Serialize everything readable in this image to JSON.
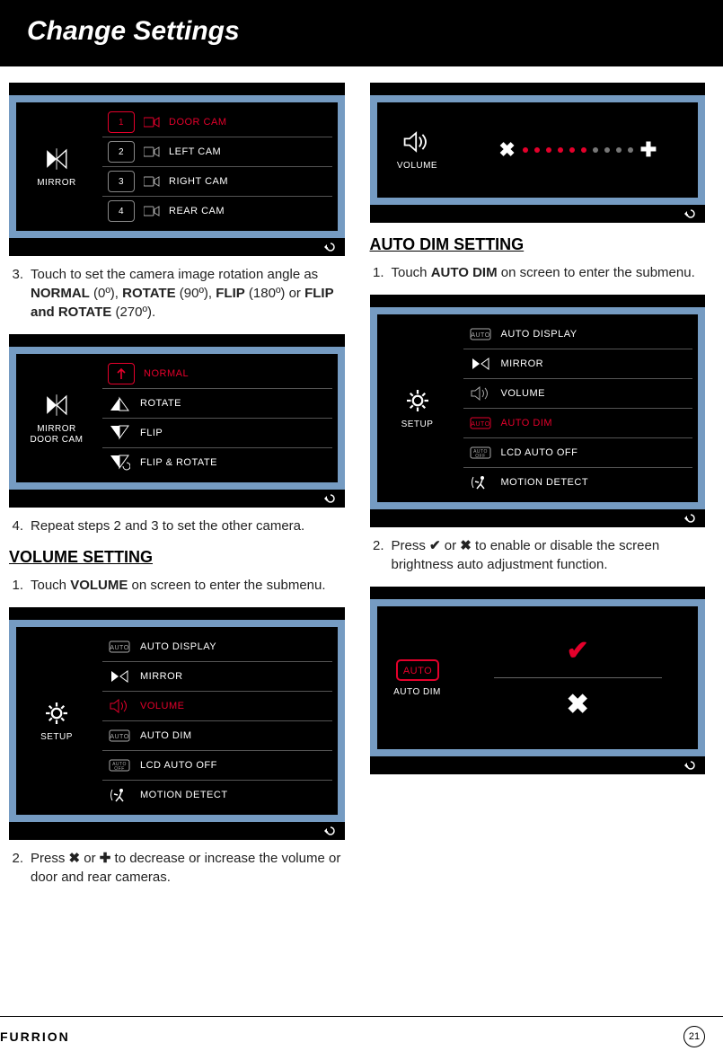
{
  "header": {
    "title": "Change Settings"
  },
  "footer": {
    "brand": "FURRION",
    "page": "21"
  },
  "left": {
    "mirror_shot": {
      "side_label": "MIRROR",
      "rows": [
        {
          "num": "1",
          "label": "DOOR CAM",
          "selected": true
        },
        {
          "num": "2",
          "label": "LEFT CAM",
          "selected": false
        },
        {
          "num": "3",
          "label": "RIGHT CAM",
          "selected": false
        },
        {
          "num": "4",
          "label": "REAR CAM",
          "selected": false
        }
      ]
    },
    "step3": {
      "num": "3.",
      "t1": "Touch to set the camera image rotation angle as ",
      "b1": "NORMAL",
      "p1": " (0º), ",
      "b2": "ROTATE",
      "p2": " (90º), ",
      "b3": "FLIP",
      "p3": " (180º) or ",
      "b4": "FLIP and ROTATE",
      "p4": " (270º)."
    },
    "rotate_shot": {
      "side_line1": "MIRROR",
      "side_line2": "DOOR CAM",
      "rows": [
        {
          "label": "NORMAL",
          "selected": true
        },
        {
          "label": "ROTATE",
          "selected": false
        },
        {
          "label": "FLIP",
          "selected": false
        },
        {
          "label": "FLIP & ROTATE",
          "selected": false
        }
      ]
    },
    "step4": {
      "num": "4.",
      "text": "Repeat steps 2 and 3 to set the other camera."
    },
    "vol_heading": "VOLUME SETTING",
    "vol_step1": {
      "num": "1.",
      "t1": "Touch ",
      "b1": "VOLUME",
      "t2": " on screen to enter the submenu."
    },
    "setup_shot_vol": {
      "side_label": "SETUP",
      "rows": [
        {
          "icon": "auto",
          "label": "AUTO DISPLAY",
          "selected": false
        },
        {
          "icon": "mirror",
          "label": "MIRROR",
          "selected": false
        },
        {
          "icon": "speaker",
          "label": "VOLUME",
          "selected": true
        },
        {
          "icon": "auto",
          "label": "AUTO DIM",
          "selected": false
        },
        {
          "icon": "autooff",
          "label": "LCD AUTO OFF",
          "selected": false
        },
        {
          "icon": "motion",
          "label": "MOTION DETECT",
          "selected": false
        }
      ]
    },
    "vol_step2": {
      "num": "2.",
      "t1": "Press ",
      "sym1": "✖",
      "t2": " or ",
      "sym2": "✚",
      "t3": " to decrease or increase the volume or door and rear cameras."
    }
  },
  "right": {
    "vol_shot": {
      "side_label": "VOLUME",
      "dots_on": 6,
      "dots_total": 10,
      "minus": "✖",
      "plus": "✚"
    },
    "autodim_heading": "AUTO DIM SETTING",
    "autodim_step1": {
      "num": "1.",
      "t1": "Touch ",
      "b1": "AUTO DIM",
      "t2": " on screen to enter the submenu."
    },
    "setup_shot_ad": {
      "side_label": "SETUP",
      "rows": [
        {
          "icon": "auto",
          "label": "AUTO DISPLAY",
          "selected": false
        },
        {
          "icon": "mirror",
          "label": "MIRROR",
          "selected": false
        },
        {
          "icon": "speaker",
          "label": "VOLUME",
          "selected": false
        },
        {
          "icon": "auto",
          "label": "AUTO DIM",
          "selected": true
        },
        {
          "icon": "autooff",
          "label": "LCD AUTO OFF",
          "selected": false
        },
        {
          "icon": "motion",
          "label": "MOTION DETECT",
          "selected": false
        }
      ]
    },
    "autodim_step2": {
      "num": "2.",
      "t1": "Press ",
      "sym1": "✔",
      "t2": " or ",
      "sym2": "✖",
      "t3": " to enable or disable the screen brightness auto adjustment function."
    },
    "autodim_shot": {
      "side_label": "AUTO DIM",
      "check": "✔",
      "x": "✖"
    }
  }
}
